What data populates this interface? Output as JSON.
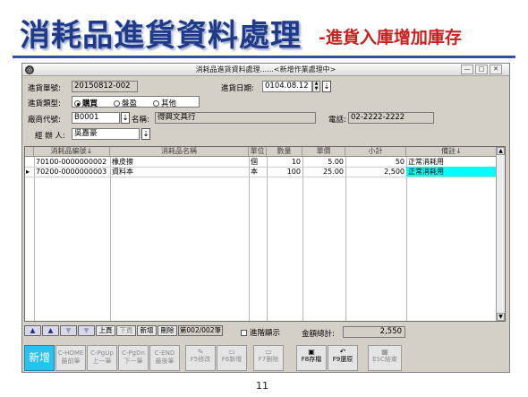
{
  "slide": {
    "title": "消耗品進貨資料處理",
    "subtitle": "-進貨入庫增加庫存",
    "page_number": "11"
  },
  "window": {
    "icon": "app-icon",
    "title": "消耗品進貨資料處理......<新增作業處理中>",
    "buttons": [
      "minimize",
      "restore",
      "close"
    ]
  },
  "form": {
    "order_no_label": "進貨單號:",
    "order_no": "20150812-002",
    "date_label": "進貨日期:",
    "date": "0104.08.12",
    "type_label": "進貨類型:",
    "type_options": [
      {
        "label": "購買",
        "checked": true
      },
      {
        "label": "盤盈",
        "checked": false
      },
      {
        "label": "其他",
        "checked": false
      }
    ],
    "vendor_code_label": "廠商代號:",
    "vendor_code": "B0001",
    "name_label": "名稱:",
    "vendor_name": "得興文具行",
    "phone_label": "電話:",
    "phone": "02-2222-2222",
    "handler_label": "經 辦 人:",
    "handler": "吳嘉豪"
  },
  "grid": {
    "columns": [
      "消耗品編號↓",
      "消耗品名稱",
      "單位",
      "數量",
      "單價",
      "小計",
      "備註↓"
    ],
    "rows": [
      {
        "code": "70100-0000000002",
        "name": "橡皮擦",
        "unit": "個",
        "qty": "10",
        "price": "5.00",
        "subtotal": "50",
        "note": "正常消耗用",
        "current": false
      },
      {
        "code": "70200-0000000003",
        "name": "資料本",
        "unit": "本",
        "qty": "100",
        "price": "25.00",
        "subtotal": "2,500",
        "note": "正常消耗用",
        "current": true
      }
    ]
  },
  "nav": {
    "prev_page": "上頁",
    "next_page": "下頁",
    "add": "新增",
    "delete": "刪除",
    "record": "第002/002筆",
    "advanced_label": "進階顯示",
    "total_label": "金額總計:",
    "total": "2,550"
  },
  "toolbar": {
    "new": "新增",
    "home_1": "C-HOME",
    "home_2": "最前筆",
    "pgup_1": "C-PgUp",
    "pgup_2": "上一筆",
    "pgdn_1": "C-PgDn",
    "pgdn_2": "下一筆",
    "end_1": "C-END",
    "end_2": "最後筆",
    "edit": "F5修改",
    "add": "F6新增",
    "delete": "F7刪除",
    "save": "F8存檔",
    "undo": "F9還原",
    "exit": "ESC結束"
  }
}
